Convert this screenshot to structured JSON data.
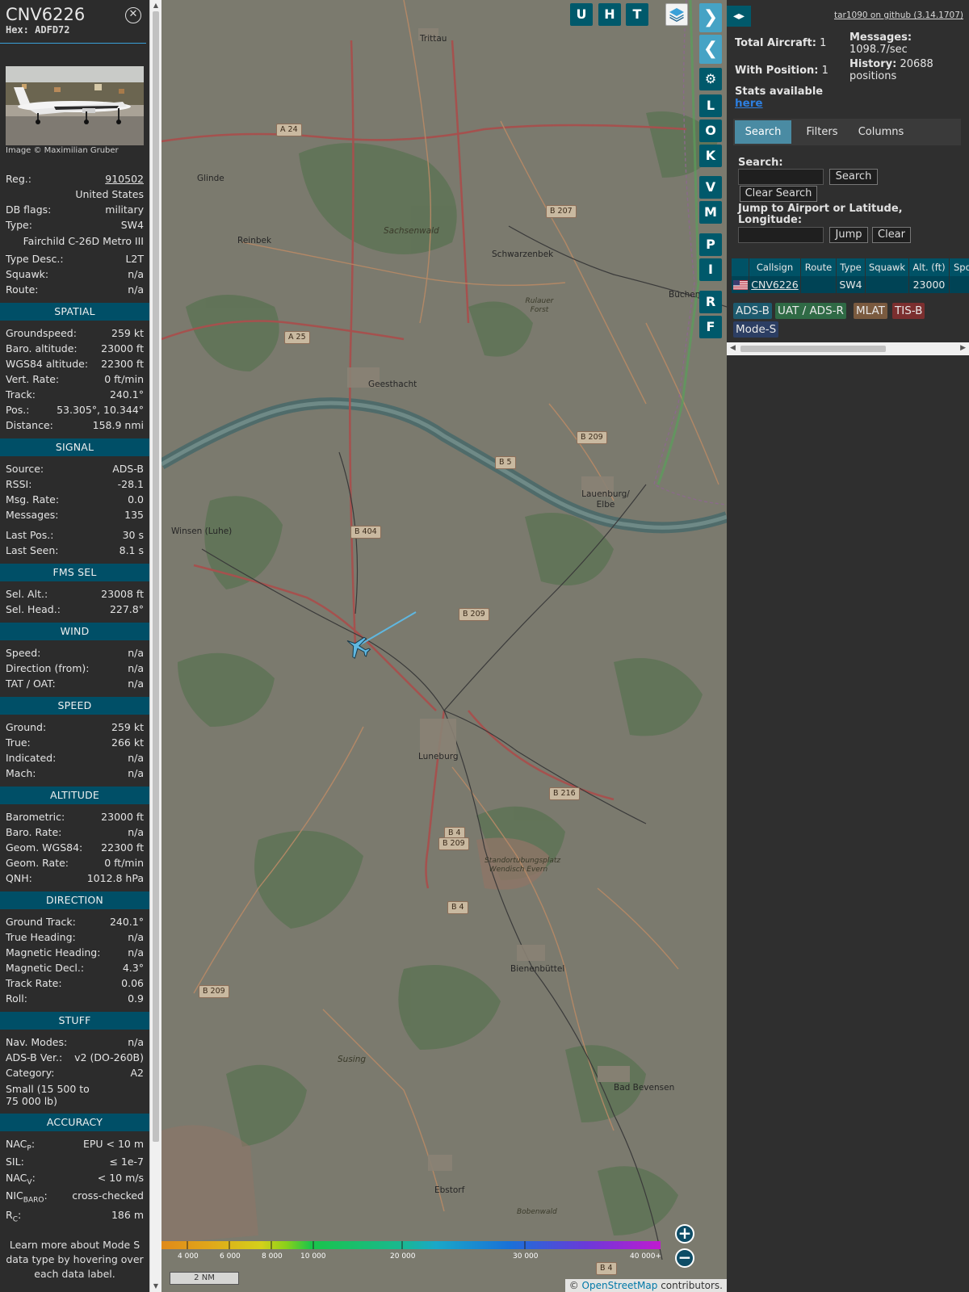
{
  "sidebar": {
    "callsign": "CNV6226",
    "hex_label": "Hex:",
    "hex": "ADFD72",
    "photo_credit": "Image © Maximilian Gruber",
    "reg_label": "Reg.:",
    "reg": "910502",
    "country": "United States",
    "dbflags_label": "DB flags:",
    "dbflags": "military",
    "type_label": "Type:",
    "type": "SW4",
    "type_full": "Fairchild C-26D Metro III",
    "typedesc_label": "Type Desc.:",
    "typedesc": "L2T",
    "squawk_label": "Squawk:",
    "squawk": "n/a",
    "route_label": "Route:",
    "route": "n/a",
    "sections": {
      "spatial": "SPATIAL",
      "signal": "SIGNAL",
      "fms": "FMS SEL",
      "wind": "WIND",
      "speed": "SPEED",
      "altitude": "ALTITUDE",
      "direction": "DIRECTION",
      "stuff": "STUFF",
      "accuracy": "ACCURACY"
    },
    "spatial": [
      {
        "label": "Groundspeed:",
        "value": "259 kt"
      },
      {
        "label": "Baro. altitude:",
        "value": "23000 ft"
      },
      {
        "label": "WGS84 altitude:",
        "value": "22300 ft"
      },
      {
        "label": "Vert. Rate:",
        "value": "0 ft/min"
      },
      {
        "label": "Track:",
        "value": "240.1°"
      },
      {
        "label": "Pos.:",
        "value": "53.305°, 10.344°"
      },
      {
        "label": "Distance:",
        "value": "158.9 nmi"
      }
    ],
    "signal": [
      {
        "label": "Source:",
        "value": "ADS-B"
      },
      {
        "label": "RSSI:",
        "value": "-28.1"
      },
      {
        "label": "Msg. Rate:",
        "value": "0.0"
      },
      {
        "label": "Messages:",
        "value": "135"
      },
      {
        "label": "Last Pos.:",
        "value": "30 s"
      },
      {
        "label": "Last Seen:",
        "value": "8.1 s"
      }
    ],
    "fms": [
      {
        "label": "Sel. Alt.:",
        "value": "23008 ft"
      },
      {
        "label": "Sel. Head.:",
        "value": "227.8°"
      }
    ],
    "wind": [
      {
        "label": "Speed:",
        "value": "n/a"
      },
      {
        "label": "Direction (from):",
        "value": "n/a"
      },
      {
        "label": "TAT / OAT:",
        "value": "n/a"
      }
    ],
    "speed": [
      {
        "label": "Ground:",
        "value": "259 kt"
      },
      {
        "label": "True:",
        "value": "266 kt"
      },
      {
        "label": "Indicated:",
        "value": "n/a"
      },
      {
        "label": "Mach:",
        "value": "n/a"
      }
    ],
    "altitude": [
      {
        "label": "Barometric:",
        "value": "23000 ft"
      },
      {
        "label": "Baro. Rate:",
        "value": "n/a"
      },
      {
        "label": "Geom. WGS84:",
        "value": "22300 ft"
      },
      {
        "label": "Geom. Rate:",
        "value": "0 ft/min"
      },
      {
        "label": "QNH:",
        "value": "1012.8 hPa"
      }
    ],
    "direction": [
      {
        "label": "Ground Track:",
        "value": "240.1°"
      },
      {
        "label": "True Heading:",
        "value": "n/a"
      },
      {
        "label": "Magnetic Heading:",
        "value": "n/a"
      },
      {
        "label": "Magnetic Decl.:",
        "value": "4.3°"
      },
      {
        "label": "Track Rate:",
        "value": "0.06"
      },
      {
        "label": "Roll:",
        "value": "0.9"
      }
    ],
    "stuff": [
      {
        "label": "Nav. Modes:",
        "value": "n/a"
      },
      {
        "label": "ADS-B Ver.:",
        "value": "v2 (DO-260B)"
      },
      {
        "label": "Category:",
        "value": "A2"
      }
    ],
    "category_desc": "Small (15 500 to 75 000 lb)",
    "accuracy": {
      "nacp_label": "NAC",
      "nacp_sub": "P",
      "nacp": "EPU < 10 m",
      "sil_label": "SIL:",
      "sil": "≤ 1e-7",
      "nacv_label": "NAC",
      "nacv_sub": "V",
      "nacv": "< 10 m/s",
      "nicbaro_label": "NIC",
      "nicbaro_sub": "BARO",
      "nicbaro": "cross-checked",
      "rc_label": "R",
      "rc_sub": "C",
      "rc": "186 m"
    },
    "note": "Learn more about Mode S data type by hovering over each data label."
  },
  "map": {
    "buttons_top": [
      "U",
      "H",
      "T"
    ],
    "buttons_side": [
      "L",
      "O",
      "K",
      "V",
      "M",
      "P",
      "I",
      "R",
      "F"
    ],
    "places": [
      {
        "name": "Trittau"
      },
      {
        "name": "Glinde"
      },
      {
        "name": "Reinbek"
      },
      {
        "name": "Sachsenwald"
      },
      {
        "name": "Schwarzenbek"
      },
      {
        "name": "Büchen"
      },
      {
        "name": "Geesthacht"
      },
      {
        "name": "Lauenburg/ Elbe"
      },
      {
        "name": "Winsen (Luhe)"
      },
      {
        "name": "Luneburg"
      },
      {
        "name": "Bienenbüttel"
      },
      {
        "name": "Susing"
      },
      {
        "name": "Bad Bevensen"
      },
      {
        "name": "Ebstorf"
      },
      {
        "name": "Standortubungsplatz Wendisch Evern"
      },
      {
        "name": "Rulauer Forst"
      },
      {
        "name": "Bobenwald"
      }
    ],
    "roads": [
      "A 24",
      "B 207",
      "A 25",
      "B 209",
      "B 5",
      "B 404",
      "B 209",
      "B 216",
      "B 4",
      "B 209",
      "B 4",
      "B 209",
      "B 4"
    ],
    "alt_ticks": [
      "4 000",
      "6 000",
      "8 000",
      "10 000",
      "20 000",
      "30 000",
      "40 000+"
    ],
    "scale": "2 NM",
    "attribution_prefix": "© ",
    "attribution_link": "OpenStreetMap",
    "attribution_suffix": " contributors."
  },
  "panel": {
    "github": "tar1090 on github (3.14.1707)",
    "total_aircraft_label": "Total Aircraft:",
    "total_aircraft": "1",
    "with_position_label": "With Position:",
    "with_position": "1",
    "stats_label": "Stats available",
    "stats_link": "here",
    "messages_label": "Messages:",
    "messages": "1098.7/sec",
    "history_label": "History:",
    "history": "20688 positions",
    "tabs": [
      "Search",
      "Filters",
      "Columns"
    ],
    "search_label": "Search:",
    "search_button": "Search",
    "clear_search": "Clear Search",
    "jump_label": "Jump to Airport or Latitude, Longitude:",
    "jump_button": "Jump",
    "clear_button": "Clear",
    "columns": [
      "",
      "Callsign",
      "Route",
      "Type",
      "Squawk",
      "Alt. (ft)",
      "Spd"
    ],
    "row": {
      "callsign": "CNV6226",
      "route": "",
      "type": "SW4",
      "squawk": "",
      "alt": "23000"
    },
    "legend": [
      {
        "label": "ADS-B",
        "color": "#1d5a6e"
      },
      {
        "label": "UAT / ADS-R",
        "color": "#2f6a45"
      },
      {
        "label": "MLAT",
        "color": "#7a5a3f"
      },
      {
        "label": "TIS-B",
        "color": "#7b2f2f"
      },
      {
        "label": "Mode-S",
        "color": "#2c3e63"
      }
    ]
  }
}
